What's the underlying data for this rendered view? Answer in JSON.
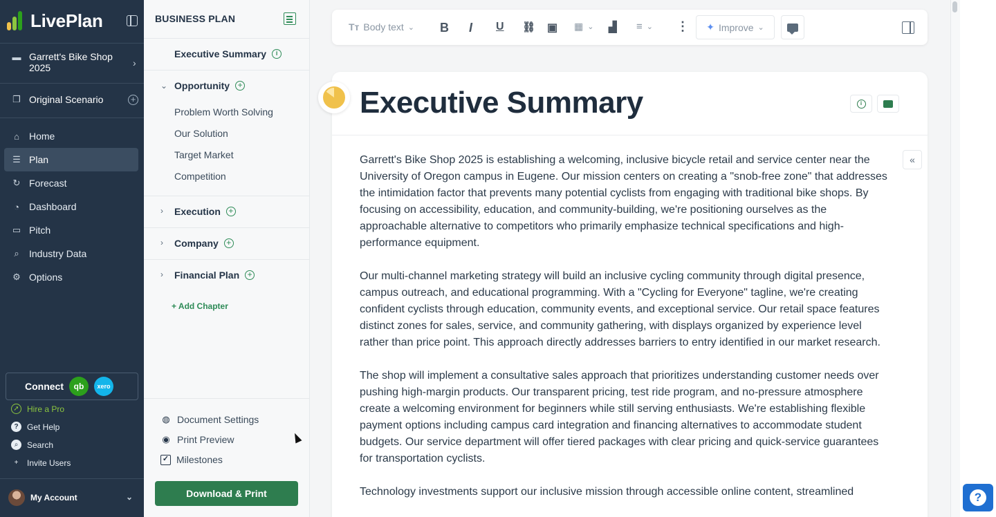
{
  "app": {
    "name": "LivePlan"
  },
  "nav": {
    "company": "Garrett's Bike Shop 2025",
    "scenario": "Original Scenario",
    "items": [
      {
        "label": "Home",
        "icon": "home-icon"
      },
      {
        "label": "Plan",
        "icon": "plan-list-icon",
        "active": true
      },
      {
        "label": "Forecast",
        "icon": "forecast-icon"
      },
      {
        "label": "Dashboard",
        "icon": "dashboard-gauge-icon"
      },
      {
        "label": "Pitch",
        "icon": "pitch-presentation-icon"
      },
      {
        "label": "Industry Data",
        "icon": "industry-search-icon"
      },
      {
        "label": "Options",
        "icon": "gear-icon"
      }
    ],
    "connect": {
      "label": "Connect",
      "qb": "qb",
      "xero": "xero"
    },
    "utilities": [
      {
        "label": "Hire a Pro",
        "icon": "compass-icon"
      },
      {
        "label": "Get Help",
        "icon": "help-icon"
      },
      {
        "label": "Search",
        "icon": "search-icon"
      },
      {
        "label": "Invite Users",
        "icon": "add-user-icon"
      }
    ],
    "account": "My Account"
  },
  "outline": {
    "heading": "BUSINESS PLAN",
    "executive_summary": "Executive Summary",
    "chapters": [
      {
        "title": "Opportunity",
        "expanded": true,
        "sections": [
          "Problem Worth Solving",
          "Our Solution",
          "Target Market",
          "Competition"
        ]
      },
      {
        "title": "Execution",
        "expanded": false
      },
      {
        "title": "Company",
        "expanded": false
      },
      {
        "title": "Financial Plan",
        "expanded": false
      }
    ],
    "add_chapter": "+ Add Chapter",
    "tools": [
      "Document Settings",
      "Print Preview",
      "Milestones"
    ],
    "download": "Download & Print"
  },
  "toolbar": {
    "text_style": "Body text",
    "improve": "Improve"
  },
  "document": {
    "title": "Executive Summary",
    "progress_fraction": 0.85,
    "paragraphs": [
      "Garrett's Bike Shop 2025 is establishing a welcoming, inclusive bicycle retail and service center near the University of Oregon campus in Eugene. Our mission centers on creating a \"snob-free zone\" that addresses the intimidation factor that prevents many potential cyclists from engaging with traditional bike shops. By focusing on accessibility, education, and community-building, we're positioning ourselves as the approachable alternative to competitors who primarily emphasize technical specifications and high-performance equipment.",
      "Our multi-channel marketing strategy will build an inclusive cycling community through digital presence, campus outreach, and educational programming. With a \"Cycling for Everyone\" tagline, we're creating confident cyclists through education, community events, and exceptional service. Our retail space features distinct zones for sales, service, and community gathering, with displays organized by experience level rather than price point. This approach directly addresses barriers to entry identified in our market research.",
      "The shop will implement a consultative sales approach that prioritizes understanding customer needs over pushing high-margin products. Our transparent pricing, test ride program, and no-pressure atmosphere create a welcoming environment for beginners while still serving enthusiasts. We're establishing flexible payment options including campus card integration and financing alternatives to accommodate student budgets. Our service department will offer tiered packages with clear pricing and quick-service guarantees for transportation cyclists.",
      "Technology investments support our inclusive mission through accessible online content, streamlined"
    ]
  },
  "colors": {
    "nav_bg": "#243447",
    "accent_green": "#2e7d4f",
    "progress_yellow": "#f0c14b",
    "help_blue": "#1f6fd1"
  }
}
